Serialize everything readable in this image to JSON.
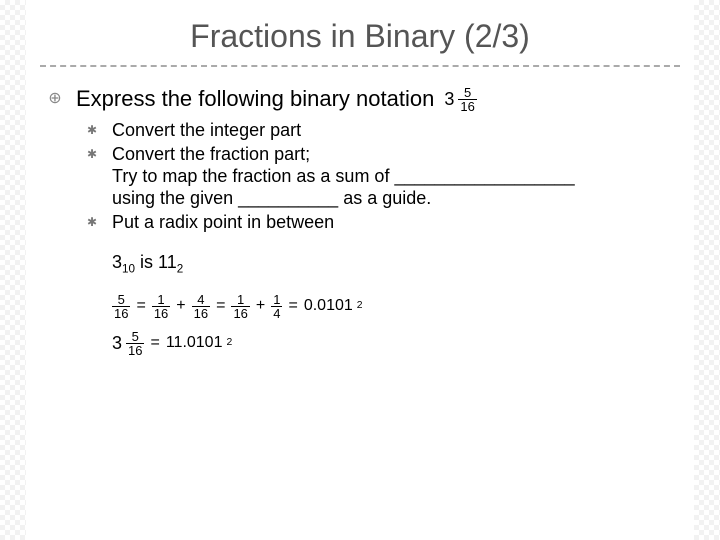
{
  "title": "Fractions in Binary (2/3)",
  "main": {
    "text": "Express the following binary notation",
    "mixed": {
      "whole": "3",
      "num": "5",
      "den": "16"
    }
  },
  "sub": {
    "a": "Convert the integer part",
    "b_line1": "Convert the fraction part;",
    "b_line2": "Try to map the fraction as a sum of __________________",
    "b_line3": "using the given __________ as a guide.",
    "c": "Put a radix point in between"
  },
  "extra": {
    "int_line": {
      "pre": "3",
      "sub1": "10",
      "mid": " is 11",
      "sub2": "2"
    },
    "eq1": {
      "lhs": {
        "num": "5",
        "den": "16"
      },
      "t1": {
        "num": "1",
        "den": "16"
      },
      "t2": {
        "num": "4",
        "den": "16"
      },
      "alt1": {
        "num": "1",
        "den": "16"
      },
      "alt2": {
        "num": "1",
        "den": "4"
      },
      "result": "0.0101",
      "base": "2"
    },
    "eq2": {
      "mixed": {
        "whole": "3",
        "num": "5",
        "den": "16"
      },
      "result": "11.0101",
      "base": "2"
    }
  }
}
